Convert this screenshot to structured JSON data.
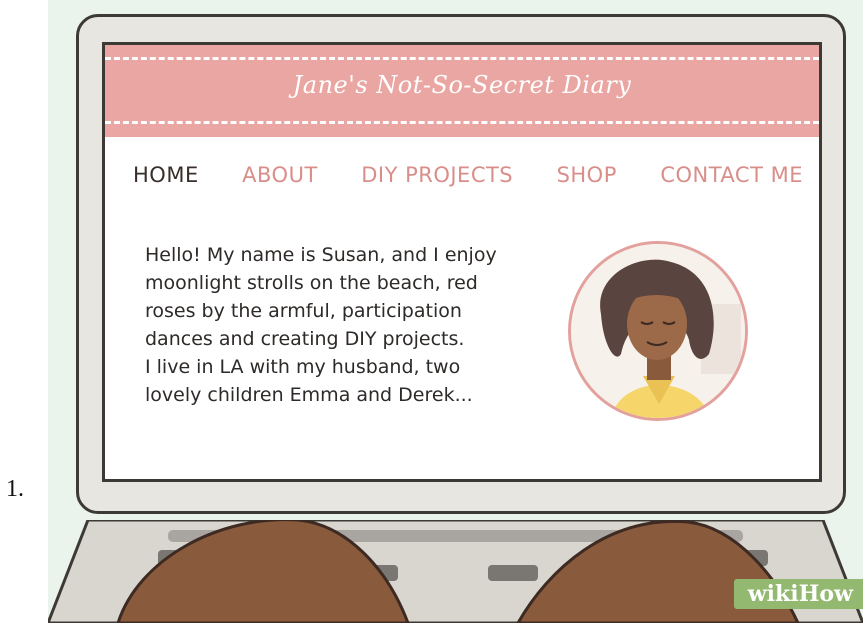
{
  "list": {
    "number": "1."
  },
  "site": {
    "title": "Jane's Not-So-Secret Diary",
    "nav": [
      {
        "label": "HOME",
        "active": true
      },
      {
        "label": "ABOUT",
        "active": false
      },
      {
        "label": "DIY PROJECTS",
        "active": false
      },
      {
        "label": "SHOP",
        "active": false
      },
      {
        "label": "CONTACT ME",
        "active": false
      }
    ],
    "bio": "Hello! My name is Susan, and I enjoy\nmoonlight strolls on the beach, red\nroses by the armful, participation\ndances and creating DIY projects.\nI live in LA with my husband, two\nlovely children Emma and Derek..."
  },
  "watermark": {
    "text": "wikiHow"
  },
  "colors": {
    "banner": "#e9a6a2",
    "nav_link": "#d98e8a",
    "nav_active": "#3a2e2a",
    "background": "#eaf4ec",
    "watermark_bg": "#93b86f"
  }
}
